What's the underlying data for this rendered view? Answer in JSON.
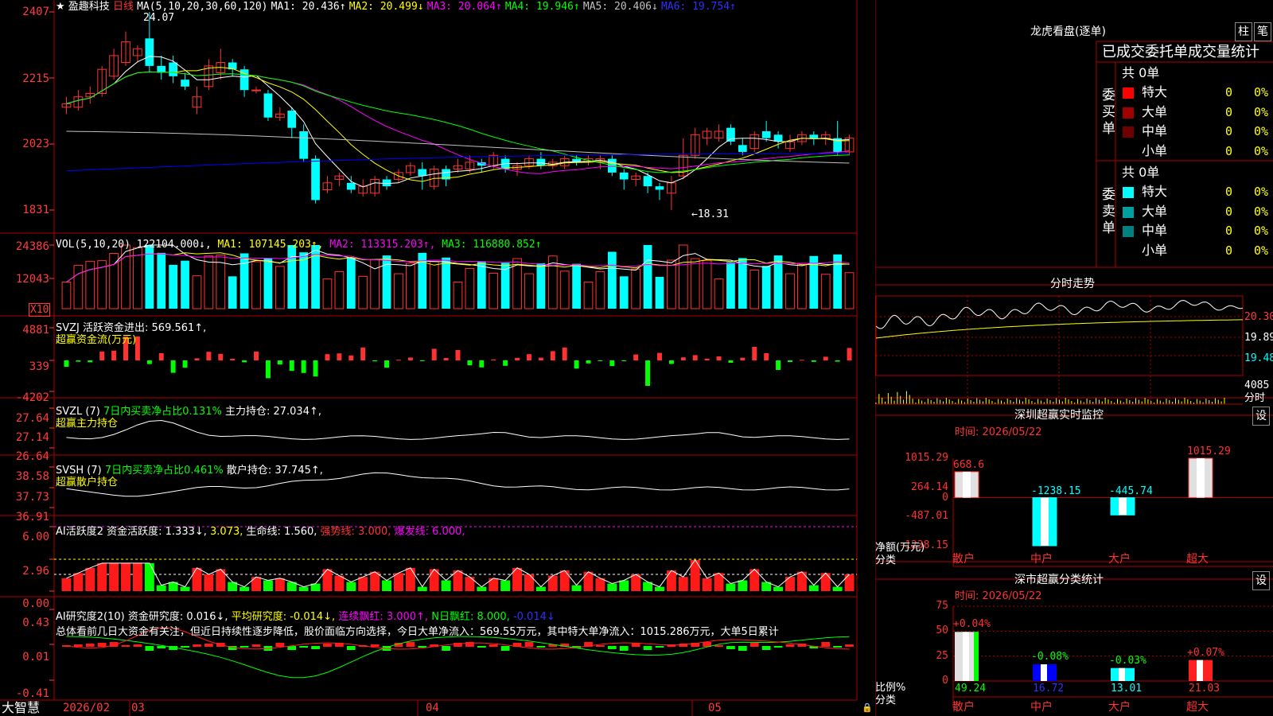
{
  "colors": {
    "up": "#ff3232",
    "down": "#00ffff",
    "grid": "#b00000",
    "axis": "#ff3c3c",
    "ma1": "#ffffff",
    "ma2": "#ffff00",
    "ma3": "#ff00ff",
    "ma4": "#00ff00",
    "ma5": "#c0c0c0",
    "ma6": "#0000ff"
  },
  "header": {
    "star": "★",
    "stock": "盈趣科技",
    "period": "日线",
    "ma_params": "MA(5,10,20,30,60,120)",
    "ma1": "MA1: 20.436↑",
    "ma2": "MA2: 20.499↓",
    "ma3": "MA3: 20.064↑",
    "ma4": "MA4: 19.946↑",
    "ma5": "MA5: 20.406↓",
    "ma6": "MA6: 19.754↑"
  },
  "price_panel": {
    "y_labels": [
      "2407",
      "2215",
      "2023",
      "1831"
    ],
    "high_mark": "24.07",
    "low_mark": "←18.31",
    "candles": [
      {
        "o": 21.3,
        "c": 21.4,
        "h": 21.6,
        "l": 21.1
      },
      {
        "o": 21.3,
        "c": 21.6,
        "h": 21.8,
        "l": 21.2
      },
      {
        "o": 21.6,
        "c": 21.7,
        "h": 21.9,
        "l": 21.4
      },
      {
        "o": 21.7,
        "c": 22.4,
        "h": 22.5,
        "l": 21.6
      },
      {
        "o": 22.2,
        "c": 22.8,
        "h": 23.0,
        "l": 22.1
      },
      {
        "o": 22.6,
        "c": 23.2,
        "h": 23.5,
        "l": 22.5
      },
      {
        "o": 22.8,
        "c": 23.0,
        "h": 23.1,
        "l": 22.6
      },
      {
        "o": 23.3,
        "c": 22.5,
        "h": 24.07,
        "l": 22.3
      },
      {
        "o": 22.5,
        "c": 22.3,
        "h": 22.8,
        "l": 22.1
      },
      {
        "o": 22.6,
        "c": 22.2,
        "h": 22.8,
        "l": 22.0
      },
      {
        "o": 22.1,
        "c": 21.9,
        "h": 22.3,
        "l": 21.8
      },
      {
        "o": 21.3,
        "c": 21.6,
        "h": 21.9,
        "l": 21.1
      },
      {
        "o": 21.9,
        "c": 22.5,
        "h": 22.7,
        "l": 21.8
      },
      {
        "o": 22.3,
        "c": 22.6,
        "h": 23.0,
        "l": 22.1
      },
      {
        "o": 22.6,
        "c": 22.4,
        "h": 22.7,
        "l": 22.2
      },
      {
        "o": 22.4,
        "c": 21.8,
        "h": 22.5,
        "l": 21.6
      },
      {
        "o": 21.8,
        "c": 21.8,
        "h": 21.9,
        "l": 21.7
      },
      {
        "o": 21.7,
        "c": 21.0,
        "h": 21.8,
        "l": 20.9
      },
      {
        "o": 21.0,
        "c": 21.1,
        "h": 21.3,
        "l": 20.9
      },
      {
        "o": 21.2,
        "c": 20.7,
        "h": 21.3,
        "l": 20.4
      },
      {
        "o": 20.6,
        "c": 19.8,
        "h": 20.8,
        "l": 19.7
      },
      {
        "o": 19.8,
        "c": 18.6,
        "h": 19.9,
        "l": 18.5
      },
      {
        "o": 18.9,
        "c": 19.1,
        "h": 19.3,
        "l": 18.8
      },
      {
        "o": 19.2,
        "c": 19.3,
        "h": 19.4,
        "l": 19.0
      },
      {
        "o": 19.1,
        "c": 18.9,
        "h": 19.3,
        "l": 18.8
      },
      {
        "o": 18.8,
        "c": 19.0,
        "h": 19.2,
        "l": 18.7
      },
      {
        "o": 18.8,
        "c": 19.2,
        "h": 19.3,
        "l": 18.7
      },
      {
        "o": 19.2,
        "c": 19.0,
        "h": 19.3,
        "l": 18.9
      },
      {
        "o": 19.2,
        "c": 19.4,
        "h": 19.5,
        "l": 19.1
      },
      {
        "o": 19.4,
        "c": 19.6,
        "h": 19.7,
        "l": 19.3
      },
      {
        "o": 19.5,
        "c": 19.3,
        "h": 19.7,
        "l": 18.9
      },
      {
        "o": 19.0,
        "c": 19.5,
        "h": 19.6,
        "l": 18.9
      },
      {
        "o": 19.5,
        "c": 19.2,
        "h": 19.6,
        "l": 19.0
      },
      {
        "o": 19.5,
        "c": 19.6,
        "h": 19.8,
        "l": 19.4
      },
      {
        "o": 19.5,
        "c": 19.7,
        "h": 19.9,
        "l": 19.4
      },
      {
        "o": 19.7,
        "c": 19.6,
        "h": 19.8,
        "l": 19.4
      },
      {
        "o": 19.6,
        "c": 19.9,
        "h": 20.0,
        "l": 19.5
      },
      {
        "o": 19.8,
        "c": 19.5,
        "h": 19.9,
        "l": 19.4
      },
      {
        "o": 19.5,
        "c": 19.6,
        "h": 19.7,
        "l": 19.3
      },
      {
        "o": 19.6,
        "c": 19.8,
        "h": 19.9,
        "l": 19.5
      },
      {
        "o": 19.8,
        "c": 19.6,
        "h": 20.0,
        "l": 19.5
      },
      {
        "o": 19.6,
        "c": 19.7,
        "h": 19.8,
        "l": 19.5
      },
      {
        "o": 19.6,
        "c": 19.8,
        "h": 19.9,
        "l": 19.5
      },
      {
        "o": 19.8,
        "c": 19.7,
        "h": 19.9,
        "l": 19.6
      },
      {
        "o": 19.7,
        "c": 19.8,
        "h": 19.9,
        "l": 19.6
      },
      {
        "o": 19.7,
        "c": 19.8,
        "h": 19.9,
        "l": 19.5
      },
      {
        "o": 19.8,
        "c": 19.4,
        "h": 19.9,
        "l": 19.3
      },
      {
        "o": 19.4,
        "c": 19.2,
        "h": 19.5,
        "l": 18.9
      },
      {
        "o": 19.2,
        "c": 19.3,
        "h": 19.4,
        "l": 19.0
      },
      {
        "o": 19.3,
        "c": 19.0,
        "h": 19.4,
        "l": 18.8
      },
      {
        "o": 19.0,
        "c": 18.9,
        "h": 19.1,
        "l": 18.6
      },
      {
        "o": 18.8,
        "c": 19.1,
        "h": 19.3,
        "l": 18.31
      },
      {
        "o": 19.3,
        "c": 19.9,
        "h": 20.4,
        "l": 19.2
      },
      {
        "o": 19.9,
        "c": 20.5,
        "h": 20.7,
        "l": 19.8
      },
      {
        "o": 20.4,
        "c": 20.6,
        "h": 20.7,
        "l": 20.2
      },
      {
        "o": 20.4,
        "c": 20.6,
        "h": 20.8,
        "l": 20.3
      },
      {
        "o": 20.7,
        "c": 20.3,
        "h": 20.8,
        "l": 20.2
      },
      {
        "o": 20.2,
        "c": 20.0,
        "h": 20.4,
        "l": 19.9
      },
      {
        "o": 20.1,
        "c": 20.5,
        "h": 20.6,
        "l": 20.0
      },
      {
        "o": 20.6,
        "c": 20.4,
        "h": 20.9,
        "l": 20.3
      },
      {
        "o": 20.5,
        "c": 20.3,
        "h": 20.6,
        "l": 20.1
      },
      {
        "o": 20.1,
        "c": 20.3,
        "h": 20.5,
        "l": 20.0
      },
      {
        "o": 20.3,
        "c": 20.5,
        "h": 20.6,
        "l": 20.2
      },
      {
        "o": 20.5,
        "c": 20.4,
        "h": 20.6,
        "l": 20.2
      },
      {
        "o": 20.4,
        "c": 20.5,
        "h": 20.6,
        "l": 20.2
      },
      {
        "o": 20.4,
        "c": 20.0,
        "h": 20.9,
        "l": 19.9
      },
      {
        "o": 20.0,
        "c": 20.4,
        "h": 20.5,
        "l": 19.9
      }
    ]
  },
  "vol_panel": {
    "title": "VOL(5,10,20)",
    "value": "122104.000↓,",
    "ma1": "MA1: 107145.203↑,",
    "ma2": "MA2: 113315.203↑,",
    "ma3": "MA3: 116880.852↑",
    "y_labels": [
      "24386",
      "12043"
    ],
    "unit": "X10"
  },
  "svzj_panel": {
    "title": "SVZJ  活跃资金进出: 569.561↑,",
    "subtitle": "超赢资金流(万元)",
    "y_labels": [
      "4881",
      "339",
      "-4202"
    ]
  },
  "svzl_panel": {
    "title": "SVZL (7)",
    "ratio": "7日内买卖净占比0.131%",
    "hold": "主力持仓: 27.034↑,",
    "subtitle": "超赢主力持仓",
    "y_labels": [
      "27.64",
      "27.14",
      "26.64"
    ]
  },
  "svsh_panel": {
    "title": "SVSH (7)",
    "ratio": "7日内买卖净占比0.461%",
    "hold": "散户持仓: 37.745↑,",
    "subtitle": "超赢散户持仓",
    "y_labels": [
      "38.58",
      "37.73",
      "36.91"
    ]
  },
  "ai1_panel": {
    "title": "AI活跃度2 资金活跃度: 1.333↓,",
    "v2": "3.073,",
    "life": "生命线: 1.560,",
    "strong": "强势线: 3.000,",
    "burst": "爆发线: 6.000,",
    "y_labels": [
      "6.00",
      "2.96",
      "0.00"
    ]
  },
  "ai2_panel": {
    "title": "AI研究度2(10) 资金研究度: 0.016↓,",
    "avg": "平均研究度: -0.014↓,",
    "cont": "连续飘红: 3.000↑,",
    "nday": "N日飘红: 8.000,",
    "last": "-0.014↓",
    "comment": "总体看前几日大资金有关注，但近日持续性逐步降低，股价面临方向选择，今日大单净流入：569.55万元，其中特大单净流入：1015.286万元，大单5日累计",
    "y_labels": [
      "0.43",
      "0.01",
      "-0.41"
    ]
  },
  "bottom": {
    "brand": "大智慧",
    "dates": [
      "2026/02",
      "03",
      "04",
      "05"
    ]
  },
  "dragon": {
    "title": "龙虎看盘(逐单)",
    "btn_col": "柱",
    "btn_pen": "笔",
    "header": "已成交委托单成交量统计",
    "buy": {
      "side": "委买单",
      "total": "共 0单",
      "rows": [
        {
          "name": "特大",
          "v": "0",
          "p": "0%",
          "c": "#ff0000"
        },
        {
          "name": "大单",
          "v": "0",
          "p": "0%",
          "c": "#a00000"
        },
        {
          "name": "中单",
          "v": "0",
          "p": "0%",
          "c": "#700000"
        },
        {
          "name": "小单",
          "v": "0",
          "p": "0%",
          "c": "#000000"
        }
      ]
    },
    "sell": {
      "side": "委卖单",
      "total": "共 0单",
      "rows": [
        {
          "name": "特大",
          "v": "0",
          "p": "0%",
          "c": "#00ffff"
        },
        {
          "name": "大单",
          "v": "0",
          "p": "0%",
          "c": "#00a0a0"
        },
        {
          "name": "中单",
          "v": "0",
          "p": "0%",
          "c": "#008080"
        },
        {
          "name": "小单",
          "v": "0",
          "p": "0%",
          "c": "#000000"
        }
      ]
    }
  },
  "minute": {
    "title": "分时走势",
    "y_labels": [
      "20.30",
      "19.89",
      "19.48"
    ],
    "vol_label": "4085",
    "vol_unit": "分时"
  },
  "monitor": {
    "title": "深圳超赢实时监控",
    "btn": "设",
    "time": "时间: 2026/05/22",
    "y_labels": [
      "1015.29",
      "264.14",
      "0",
      "-487.01",
      "-1238.15"
    ],
    "axis_title": "净额(万元)",
    "cat_title": "分类",
    "cats": [
      "散户",
      "中户",
      "大户",
      "超大"
    ],
    "values": [
      668.6,
      -1238.15,
      -445.74,
      1015.29
    ],
    "value_labels": [
      "668.6",
      "-1238.15",
      "-445.74",
      "1015.29"
    ]
  },
  "classify": {
    "title": "深市超赢分类统计",
    "btn": "设",
    "time": "时间: 2026/05/22",
    "y_labels": [
      "75",
      "50",
      "25",
      "0"
    ],
    "axis_title": "比例%",
    "cat_title": "分类",
    "cats": [
      "散户",
      "中户",
      "大户",
      "超大"
    ],
    "values": [
      49.24,
      16.72,
      13.01,
      21.03
    ],
    "value_labels": [
      "49.24",
      "16.72",
      "13.01",
      "21.03"
    ],
    "changes": [
      "+0.04%",
      "-0.08%",
      "-0.03%",
      "+0.07%"
    ]
  }
}
